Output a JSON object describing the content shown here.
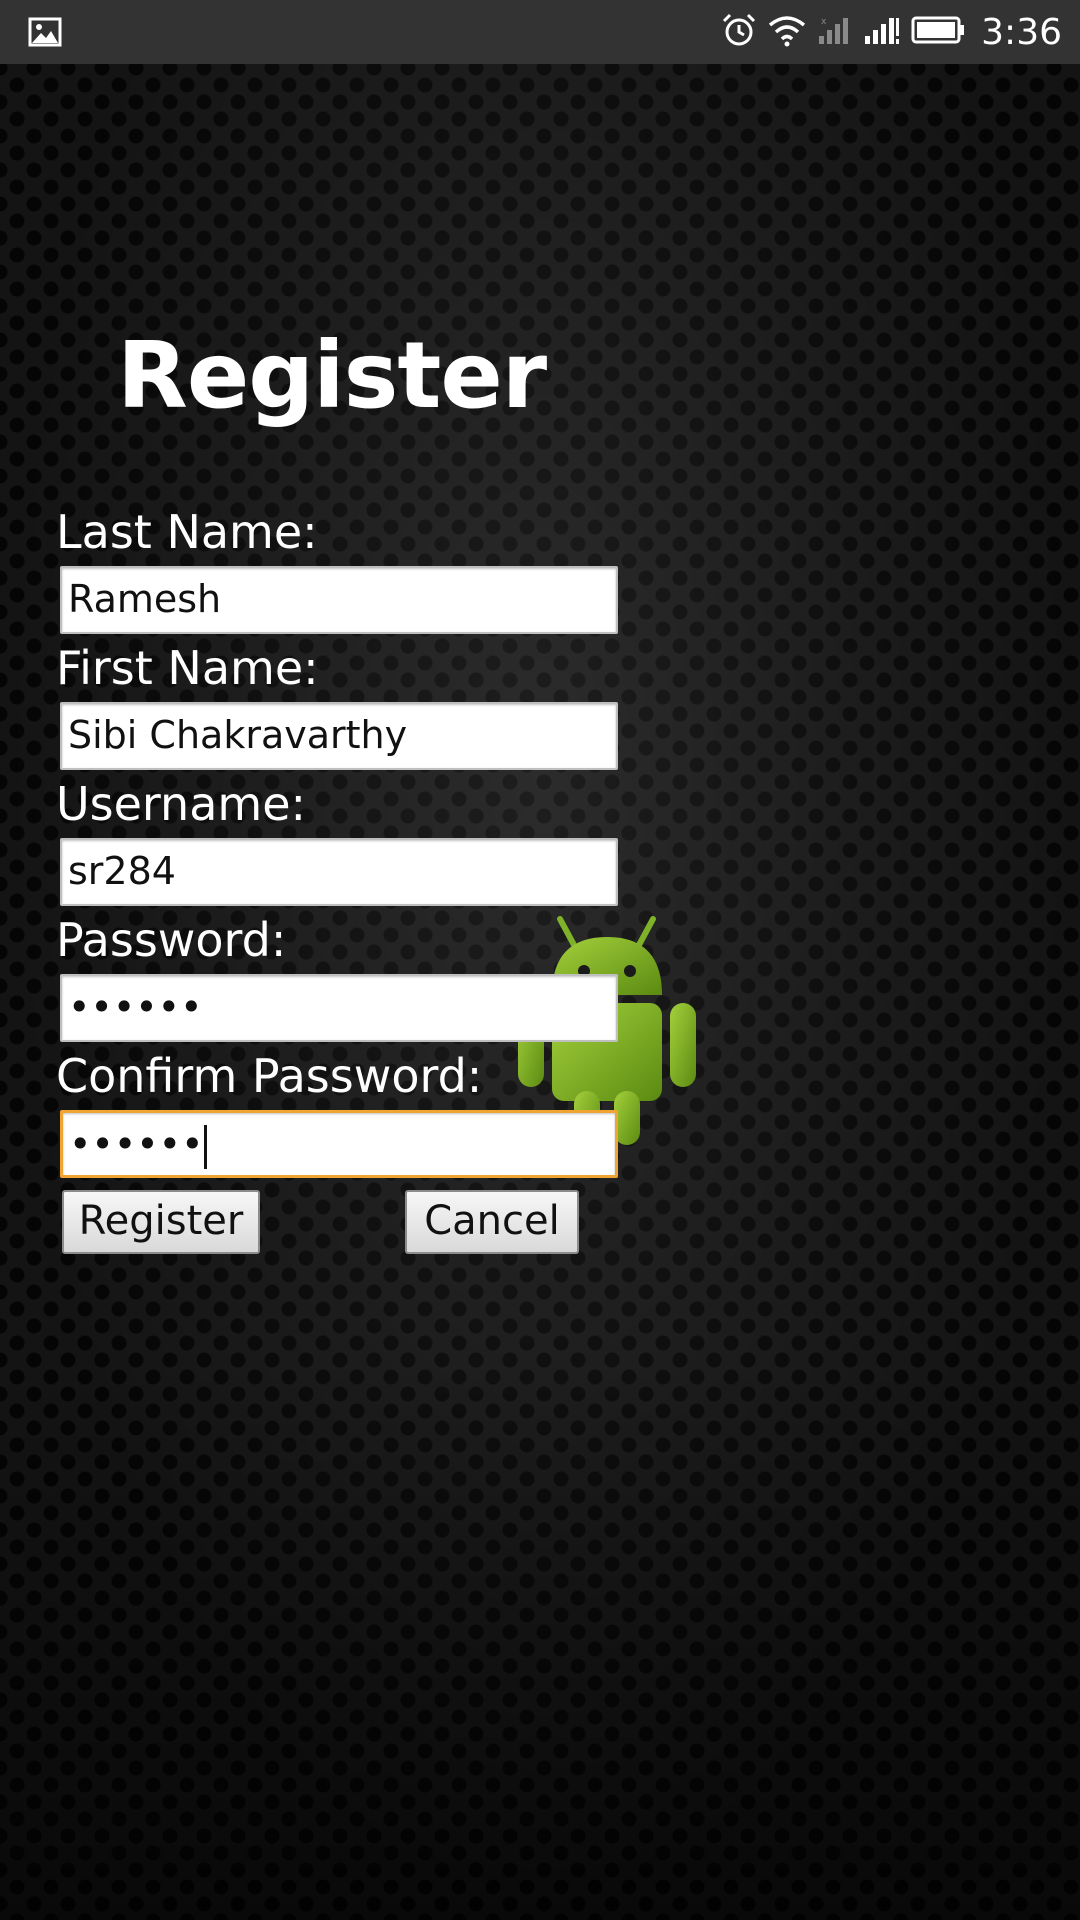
{
  "status_bar": {
    "time": "3:36",
    "icons": [
      "gallery-icon",
      "alarm-icon",
      "wifi-icon",
      "signal-sim2-icon",
      "signal-sim1-icon",
      "battery-icon"
    ]
  },
  "form": {
    "title": "Register",
    "fields": [
      {
        "label": "Last Name:",
        "value": "Ramesh"
      },
      {
        "label": "First Name:",
        "value": "Sibi Chakravarthy"
      },
      {
        "label": "Username:",
        "value": "sr284"
      },
      {
        "label": "Password:",
        "value": "••••••"
      },
      {
        "label": "Confirm Password:",
        "value": "••••••"
      }
    ],
    "register_label": "Register",
    "cancel_label": "Cancel"
  },
  "colors": {
    "focus_border": "#f0a431",
    "android_green": "#8cbf26",
    "status_bar": "#333333"
  }
}
